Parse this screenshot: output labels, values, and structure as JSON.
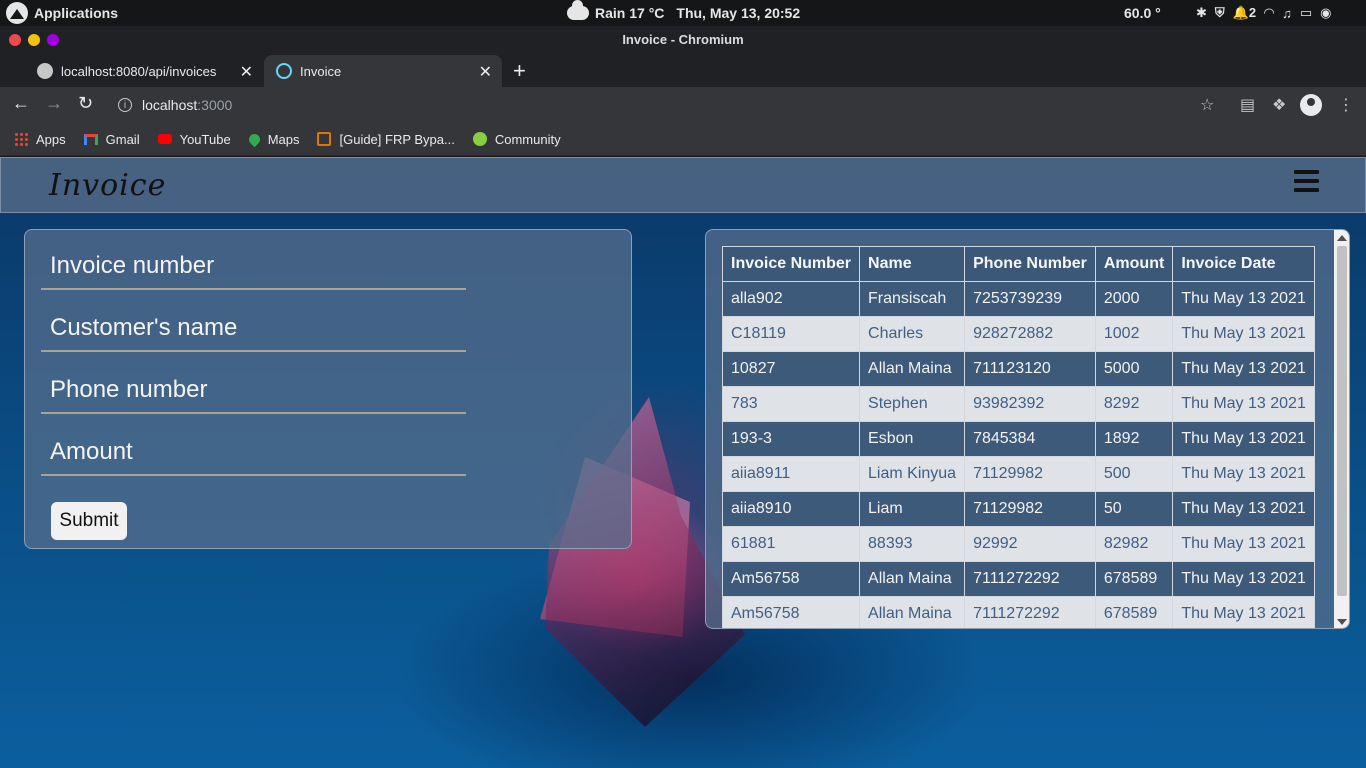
{
  "os": {
    "apps_label": "Applications",
    "weather": "Rain 17 °C",
    "datetime": "Thu, May 13, 20:52",
    "temp": "60.0 °",
    "notif_count": "2"
  },
  "window": {
    "title": "Invoice - Chromium"
  },
  "tabs": [
    {
      "label": "localhost:8080/api/invoices",
      "active": false
    },
    {
      "label": "Invoice",
      "active": true
    }
  ],
  "address": {
    "host": "localhost",
    "port": ":3000"
  },
  "bookmarks": [
    {
      "label": "Apps",
      "icon": "apps-grid-icon"
    },
    {
      "label": "Gmail",
      "icon": "gmail-icon"
    },
    {
      "label": "YouTube",
      "icon": "youtube-icon"
    },
    {
      "label": "Maps",
      "icon": "maps-icon"
    },
    {
      "label": "[Guide] FRP Bypa...",
      "icon": "bookmark-site-icon"
    },
    {
      "label": "Community",
      "icon": "community-icon"
    }
  ],
  "app": {
    "brand": "Invoice",
    "form": {
      "invoice_number_placeholder": "Invoice number",
      "customer_name_placeholder": "Customer's name",
      "phone_placeholder": "Phone number",
      "amount_placeholder": "Amount",
      "submit_label": "Submit"
    },
    "table": {
      "headers": [
        "Invoice Number",
        "Name",
        "Phone Number",
        "Amount",
        "Invoice Date"
      ],
      "rows": [
        [
          "alla902",
          "Fransiscah",
          "7253739239",
          "2000",
          "Thu May 13 2021"
        ],
        [
          "C18119",
          "Charles",
          "928272882",
          "1002",
          "Thu May 13 2021"
        ],
        [
          "10827",
          "Allan Maina",
          "711123120",
          "5000",
          "Thu May 13 2021"
        ],
        [
          "783",
          "Stephen",
          "93982392",
          "8292",
          "Thu May 13 2021"
        ],
        [
          "193-3",
          "Esbon",
          "7845384",
          "1892",
          "Thu May 13 2021"
        ],
        [
          "aiia8911",
          "Liam Kinyua",
          "71129982",
          "500",
          "Thu May 13 2021"
        ],
        [
          "aiia8910",
          "Liam",
          "71129982",
          "50",
          "Thu May 13 2021"
        ],
        [
          "61881",
          "88393",
          "92992",
          "82982",
          "Thu May 13 2021"
        ],
        [
          "Am56758",
          "Allan Maina",
          "7111272292",
          "678589",
          "Thu May 13 2021"
        ],
        [
          "Am56758",
          "Allan Maina",
          "7111272292",
          "678589",
          "Thu May 13 2021"
        ]
      ]
    }
  }
}
